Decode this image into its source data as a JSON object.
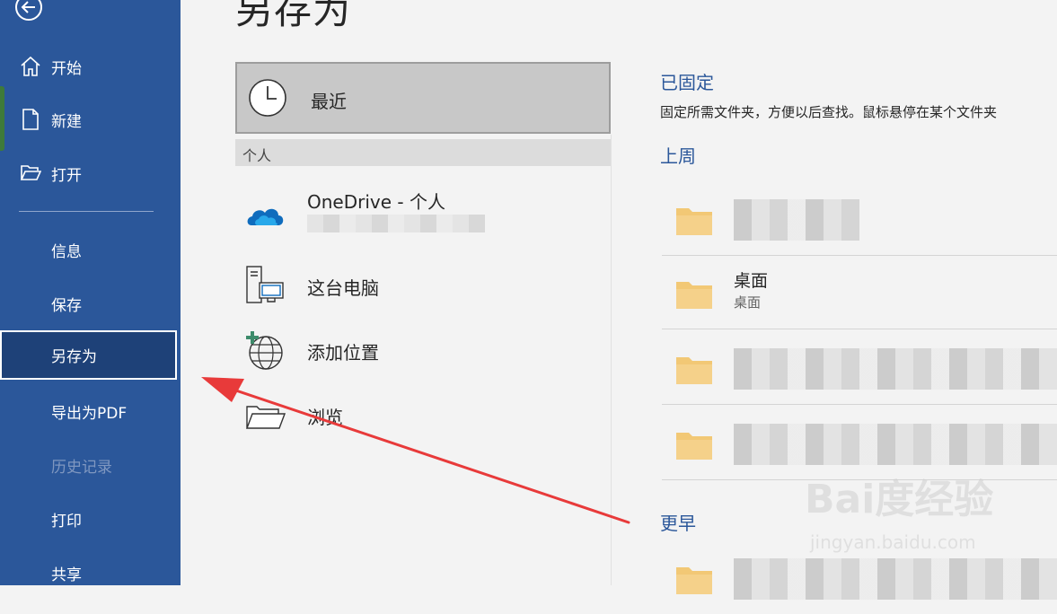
{
  "sidebar": {
    "items": [
      {
        "label": "开始"
      },
      {
        "label": "新建"
      },
      {
        "label": "打开"
      },
      {
        "label": "信息"
      },
      {
        "label": "保存"
      },
      {
        "label": "另存为"
      },
      {
        "label": "导出为PDF"
      },
      {
        "label": "历史记录"
      },
      {
        "label": "打印"
      },
      {
        "label": "共享"
      }
    ],
    "selected": "另存为",
    "accent": "#2b579a"
  },
  "main": {
    "title": "另存为",
    "locations": {
      "recent": "最近",
      "personal_header": "个人",
      "onedrive": "OneDrive - 个人",
      "this_pc": "这台电脑",
      "add_place": "添加位置",
      "browse": "浏览"
    },
    "right": {
      "pinned_title": "已固定",
      "pinned_desc": "固定所需文件夹，方便以后查找。鼠标悬停在某个文件夹",
      "last_week_title": "上周",
      "earlier_title": "更早",
      "folders": [
        {
          "name": "",
          "path": ""
        },
        {
          "name": "桌面",
          "path": "桌面"
        },
        {
          "name": "",
          "path": ""
        },
        {
          "name": "",
          "path": ""
        },
        {
          "name": "",
          "path": ""
        }
      ]
    }
  },
  "watermark": {
    "brand": "Bai度经验",
    "url": "jingyan.baidu.com"
  }
}
